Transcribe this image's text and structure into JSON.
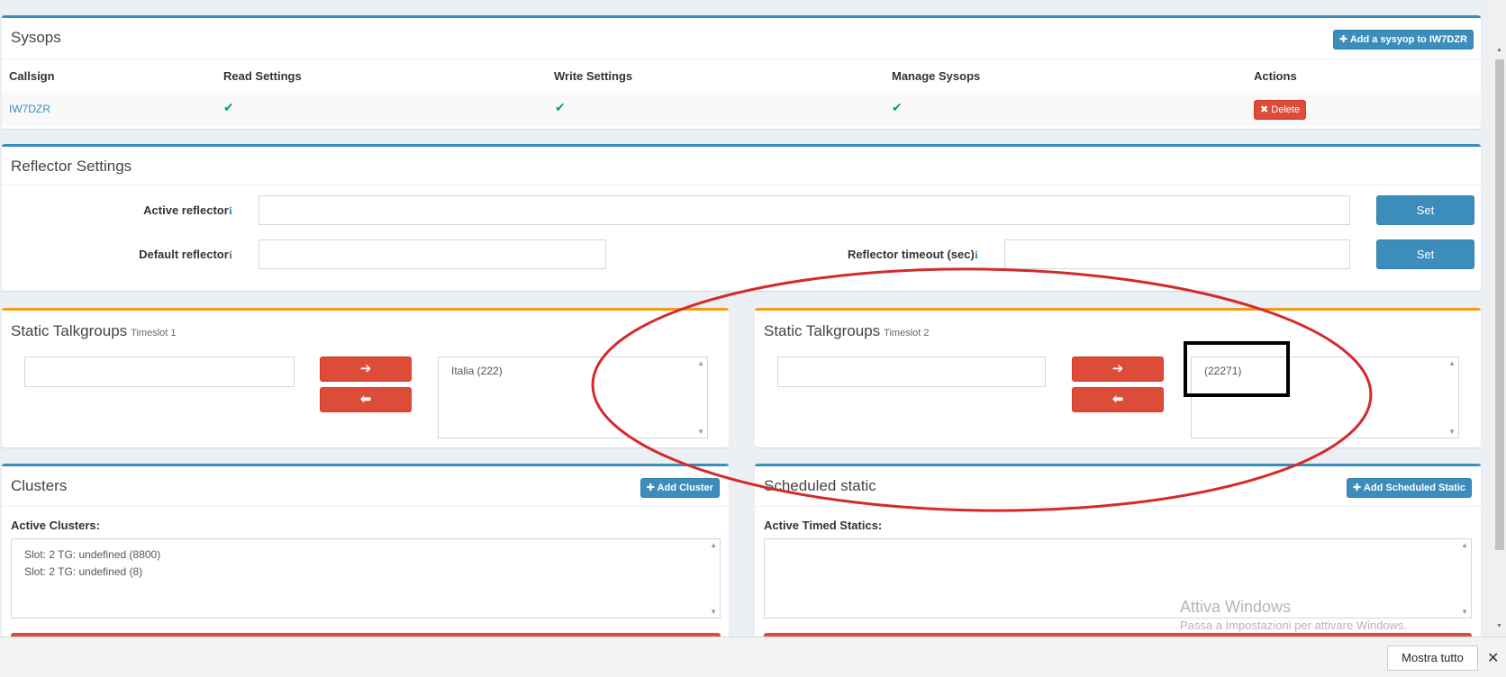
{
  "sysops": {
    "title": "Sysops",
    "add_button": "Add a sysyop to IW7DZR",
    "columns": [
      "Callsign",
      "Read Settings",
      "Write Settings",
      "Manage Sysops",
      "Actions"
    ],
    "rows": [
      {
        "callsign": "IW7DZR",
        "read": "✔",
        "write": "✔",
        "manage": "✔",
        "delete_label": "Delete"
      }
    ]
  },
  "reflector": {
    "title": "Reflector Settings",
    "active_label": "Active reflector",
    "default_label": "Default reflector",
    "timeout_label": "Reflector timeout (sec)",
    "set_label": "Set",
    "info_glyph": "ℹ"
  },
  "ts1": {
    "title": "Static Talkgroups",
    "subtitle": "Timeslot 1",
    "right_arrow": "➔",
    "left_arrow": "⬅",
    "items": [
      "Italia (222)"
    ]
  },
  "ts2": {
    "title": "Static Talkgroups",
    "subtitle": "Timeslot 2",
    "right_arrow": "➔",
    "left_arrow": "⬅",
    "items": [
      "(22271)"
    ]
  },
  "clusters": {
    "title": "Clusters",
    "add_button": "Add Cluster",
    "active_label": "Active Clusters:",
    "items": [
      "Slot: 2 TG: undefined (8800)",
      "Slot: 2 TG: undefined (8)"
    ]
  },
  "scheduled": {
    "title": "Scheduled static",
    "add_button": "Add Scheduled Static",
    "active_label": "Active Timed Statics:"
  },
  "watermark": {
    "line1": "Attiva Windows",
    "line2": "Passa a Impostazioni per attivare Windows."
  },
  "downloadbar": {
    "show_all": "Mostra tutto",
    "close": "✕"
  },
  "annotation_colors": {
    "ellipse": "#d42a2a",
    "rect": "#000000"
  }
}
